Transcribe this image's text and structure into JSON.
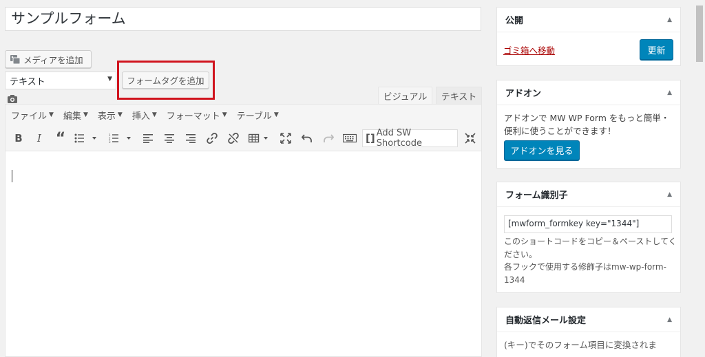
{
  "title_field": {
    "value": "サンプルフォーム"
  },
  "editor": {
    "media_button": "メディアを追加",
    "select_value": "テキスト",
    "formtag_button": "フォームタグを追加",
    "tabs": {
      "visual": "ビジュアル",
      "text": "テキスト"
    },
    "menu": [
      {
        "label": "ファイル"
      },
      {
        "label": "編集"
      },
      {
        "label": "表示"
      },
      {
        "label": "挿入"
      },
      {
        "label": "フォーマット"
      },
      {
        "label": "テーブル"
      }
    ],
    "shortcode_button": "Add SW Shortcode"
  },
  "sidebar": {
    "publish": {
      "title": "公開",
      "trash_link": "ゴミ箱へ移動",
      "update_button": "更新"
    },
    "addon": {
      "title": "アドオン",
      "desc_line1": "アドオンで MW WP Form をもっと簡単・",
      "desc_line2": "便利に使うことができます！",
      "button": "アドオンを見る"
    },
    "form_key": {
      "title": "フォーム識別子",
      "input_value": "[mwform_formkey key=\"1344\"]",
      "help_line1": "このショートコードをコピー＆ペーストしてく",
      "help_line2": "ださい。",
      "help_line3": "各フックで使用する修飾子はmw-wp-form-",
      "help_line4": "1344"
    },
    "auto_reply": {
      "title": "自動返信メール設定",
      "desc_line1": "(キー)でそのフォーム項目に変換されま"
    }
  },
  "colors": {
    "accent": "#0085ba",
    "highlight": "#d0131d",
    "trash": "#a00"
  }
}
